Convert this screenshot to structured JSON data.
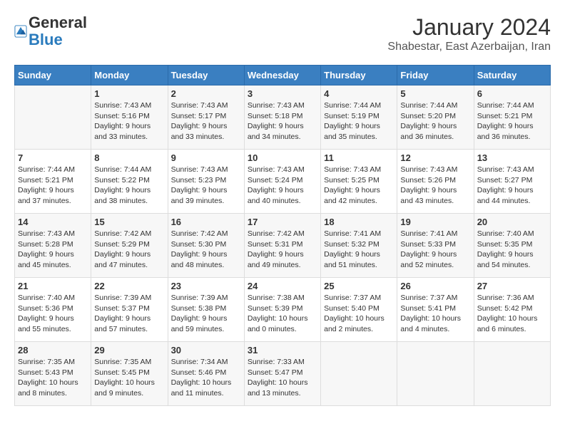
{
  "header": {
    "logo_line1": "General",
    "logo_line2": "Blue",
    "month_year": "January 2024",
    "location": "Shabestar, East Azerbaijan, Iran"
  },
  "weekdays": [
    "Sunday",
    "Monday",
    "Tuesday",
    "Wednesday",
    "Thursday",
    "Friday",
    "Saturday"
  ],
  "weeks": [
    [
      {
        "day": "",
        "sunrise": "",
        "sunset": "",
        "daylight": ""
      },
      {
        "day": "1",
        "sunrise": "Sunrise: 7:43 AM",
        "sunset": "Sunset: 5:16 PM",
        "daylight": "Daylight: 9 hours and 33 minutes."
      },
      {
        "day": "2",
        "sunrise": "Sunrise: 7:43 AM",
        "sunset": "Sunset: 5:17 PM",
        "daylight": "Daylight: 9 hours and 33 minutes."
      },
      {
        "day": "3",
        "sunrise": "Sunrise: 7:43 AM",
        "sunset": "Sunset: 5:18 PM",
        "daylight": "Daylight: 9 hours and 34 minutes."
      },
      {
        "day": "4",
        "sunrise": "Sunrise: 7:44 AM",
        "sunset": "Sunset: 5:19 PM",
        "daylight": "Daylight: 9 hours and 35 minutes."
      },
      {
        "day": "5",
        "sunrise": "Sunrise: 7:44 AM",
        "sunset": "Sunset: 5:20 PM",
        "daylight": "Daylight: 9 hours and 36 minutes."
      },
      {
        "day": "6",
        "sunrise": "Sunrise: 7:44 AM",
        "sunset": "Sunset: 5:21 PM",
        "daylight": "Daylight: 9 hours and 36 minutes."
      }
    ],
    [
      {
        "day": "7",
        "sunrise": "Sunrise: 7:44 AM",
        "sunset": "Sunset: 5:21 PM",
        "daylight": "Daylight: 9 hours and 37 minutes."
      },
      {
        "day": "8",
        "sunrise": "Sunrise: 7:44 AM",
        "sunset": "Sunset: 5:22 PM",
        "daylight": "Daylight: 9 hours and 38 minutes."
      },
      {
        "day": "9",
        "sunrise": "Sunrise: 7:43 AM",
        "sunset": "Sunset: 5:23 PM",
        "daylight": "Daylight: 9 hours and 39 minutes."
      },
      {
        "day": "10",
        "sunrise": "Sunrise: 7:43 AM",
        "sunset": "Sunset: 5:24 PM",
        "daylight": "Daylight: 9 hours and 40 minutes."
      },
      {
        "day": "11",
        "sunrise": "Sunrise: 7:43 AM",
        "sunset": "Sunset: 5:25 PM",
        "daylight": "Daylight: 9 hours and 42 minutes."
      },
      {
        "day": "12",
        "sunrise": "Sunrise: 7:43 AM",
        "sunset": "Sunset: 5:26 PM",
        "daylight": "Daylight: 9 hours and 43 minutes."
      },
      {
        "day": "13",
        "sunrise": "Sunrise: 7:43 AM",
        "sunset": "Sunset: 5:27 PM",
        "daylight": "Daylight: 9 hours and 44 minutes."
      }
    ],
    [
      {
        "day": "14",
        "sunrise": "Sunrise: 7:43 AM",
        "sunset": "Sunset: 5:28 PM",
        "daylight": "Daylight: 9 hours and 45 minutes."
      },
      {
        "day": "15",
        "sunrise": "Sunrise: 7:42 AM",
        "sunset": "Sunset: 5:29 PM",
        "daylight": "Daylight: 9 hours and 47 minutes."
      },
      {
        "day": "16",
        "sunrise": "Sunrise: 7:42 AM",
        "sunset": "Sunset: 5:30 PM",
        "daylight": "Daylight: 9 hours and 48 minutes."
      },
      {
        "day": "17",
        "sunrise": "Sunrise: 7:42 AM",
        "sunset": "Sunset: 5:31 PM",
        "daylight": "Daylight: 9 hours and 49 minutes."
      },
      {
        "day": "18",
        "sunrise": "Sunrise: 7:41 AM",
        "sunset": "Sunset: 5:32 PM",
        "daylight": "Daylight: 9 hours and 51 minutes."
      },
      {
        "day": "19",
        "sunrise": "Sunrise: 7:41 AM",
        "sunset": "Sunset: 5:33 PM",
        "daylight": "Daylight: 9 hours and 52 minutes."
      },
      {
        "day": "20",
        "sunrise": "Sunrise: 7:40 AM",
        "sunset": "Sunset: 5:35 PM",
        "daylight": "Daylight: 9 hours and 54 minutes."
      }
    ],
    [
      {
        "day": "21",
        "sunrise": "Sunrise: 7:40 AM",
        "sunset": "Sunset: 5:36 PM",
        "daylight": "Daylight: 9 hours and 55 minutes."
      },
      {
        "day": "22",
        "sunrise": "Sunrise: 7:39 AM",
        "sunset": "Sunset: 5:37 PM",
        "daylight": "Daylight: 9 hours and 57 minutes."
      },
      {
        "day": "23",
        "sunrise": "Sunrise: 7:39 AM",
        "sunset": "Sunset: 5:38 PM",
        "daylight": "Daylight: 9 hours and 59 minutes."
      },
      {
        "day": "24",
        "sunrise": "Sunrise: 7:38 AM",
        "sunset": "Sunset: 5:39 PM",
        "daylight": "Daylight: 10 hours and 0 minutes."
      },
      {
        "day": "25",
        "sunrise": "Sunrise: 7:37 AM",
        "sunset": "Sunset: 5:40 PM",
        "daylight": "Daylight: 10 hours and 2 minutes."
      },
      {
        "day": "26",
        "sunrise": "Sunrise: 7:37 AM",
        "sunset": "Sunset: 5:41 PM",
        "daylight": "Daylight: 10 hours and 4 minutes."
      },
      {
        "day": "27",
        "sunrise": "Sunrise: 7:36 AM",
        "sunset": "Sunset: 5:42 PM",
        "daylight": "Daylight: 10 hours and 6 minutes."
      }
    ],
    [
      {
        "day": "28",
        "sunrise": "Sunrise: 7:35 AM",
        "sunset": "Sunset: 5:43 PM",
        "daylight": "Daylight: 10 hours and 8 minutes."
      },
      {
        "day": "29",
        "sunrise": "Sunrise: 7:35 AM",
        "sunset": "Sunset: 5:45 PM",
        "daylight": "Daylight: 10 hours and 9 minutes."
      },
      {
        "day": "30",
        "sunrise": "Sunrise: 7:34 AM",
        "sunset": "Sunset: 5:46 PM",
        "daylight": "Daylight: 10 hours and 11 minutes."
      },
      {
        "day": "31",
        "sunrise": "Sunrise: 7:33 AM",
        "sunset": "Sunset: 5:47 PM",
        "daylight": "Daylight: 10 hours and 13 minutes."
      },
      {
        "day": "",
        "sunrise": "",
        "sunset": "",
        "daylight": ""
      },
      {
        "day": "",
        "sunrise": "",
        "sunset": "",
        "daylight": ""
      },
      {
        "day": "",
        "sunrise": "",
        "sunset": "",
        "daylight": ""
      }
    ]
  ]
}
